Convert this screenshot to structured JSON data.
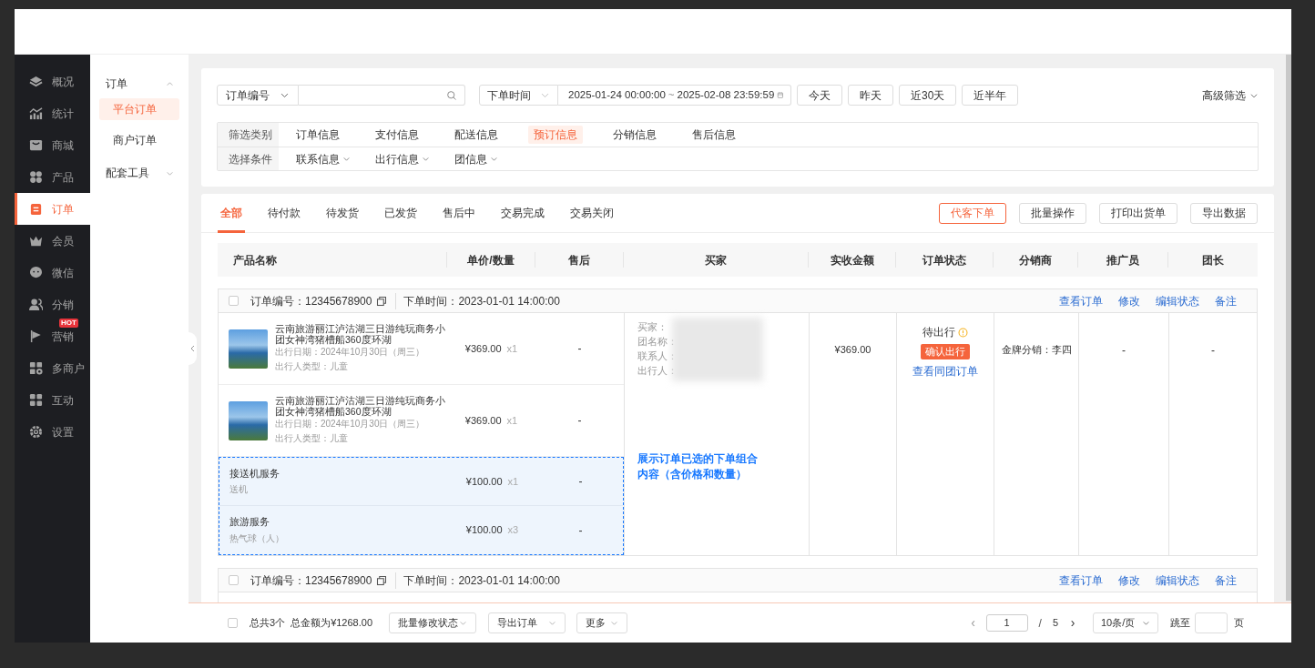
{
  "sidebar": {
    "items": [
      {
        "label": "概况",
        "selected": false
      },
      {
        "label": "统计",
        "selected": false
      },
      {
        "label": "商城",
        "selected": false
      },
      {
        "label": "产品",
        "selected": false
      },
      {
        "label": "订单",
        "selected": true
      },
      {
        "label": "会员",
        "selected": false
      },
      {
        "label": "微信",
        "selected": false
      },
      {
        "label": "分销",
        "selected": false
      },
      {
        "label": "营销",
        "selected": false,
        "badge": "HOT"
      },
      {
        "label": "多商户",
        "selected": false
      },
      {
        "label": "互动",
        "selected": false
      },
      {
        "label": "设置",
        "selected": false
      }
    ]
  },
  "submenu": {
    "groups": [
      {
        "label": "订单",
        "expanded": true,
        "children": [
          {
            "label": "平台订单",
            "selected": true
          },
          {
            "label": "商户订单",
            "selected": false
          }
        ]
      },
      {
        "label": "配套工具",
        "expanded": false
      }
    ]
  },
  "filters": {
    "search": {
      "type_select": "订单编号"
    },
    "date": {
      "type_select": "下单时间",
      "start": "2025-01-24 00:00:00",
      "separator": "~",
      "end": "2025-02-08 23:59:59"
    },
    "quick_buttons": [
      "今天",
      "昨天",
      "近30天",
      "近半年"
    ],
    "advanced": "高级筛选",
    "rows": [
      {
        "label": "筛选类别",
        "options": [
          {
            "label": "订单信息",
            "selected": false
          },
          {
            "label": "支付信息",
            "selected": false
          },
          {
            "label": "配送信息",
            "selected": false
          },
          {
            "label": "预订信息",
            "selected": true
          },
          {
            "label": "分销信息",
            "selected": false
          },
          {
            "label": "售后信息",
            "selected": false
          }
        ]
      },
      {
        "label": "选择条件",
        "dropdowns": [
          "联系信息",
          "出行信息",
          "团信息"
        ]
      }
    ]
  },
  "orders_panel": {
    "tabs": [
      {
        "label": "全部",
        "selected": true
      },
      {
        "label": "待付款",
        "selected": false
      },
      {
        "label": "待发货",
        "selected": false
      },
      {
        "label": "已发货",
        "selected": false
      },
      {
        "label": "售后中",
        "selected": false
      },
      {
        "label": "交易完成",
        "selected": false
      },
      {
        "label": "交易关闭",
        "selected": false
      }
    ],
    "actions": [
      {
        "label": "代客下单",
        "kind": "primary"
      },
      {
        "label": "批量操作",
        "kind": "default"
      },
      {
        "label": "打印出货单",
        "kind": "default"
      },
      {
        "label": "导出数据",
        "kind": "default"
      }
    ],
    "columns": [
      "产品名称",
      "单价/数量",
      "售后",
      "买家",
      "实收金额",
      "订单状态",
      "分销商",
      "推广员",
      "团长"
    ],
    "orders": [
      {
        "checked": false,
        "number_label": "订单编号：",
        "number": "12345678900",
        "time_label": "下单时间：",
        "time": "2023-01-01 14:00:00",
        "links": [
          "查看订单",
          "修改",
          "编辑状态",
          "备注"
        ],
        "items": [
          {
            "kind": "product",
            "highlighted": false,
            "title": "云南旅游丽江泸沽湖三日游纯玩商务小团女神湾猪槽船360度环湖",
            "lines": [
              "出行日期：2024年10月30日（周三）",
              "出行人类型：儿童"
            ],
            "price": "¥369.00",
            "qty": "x1",
            "after_sale": "-"
          },
          {
            "kind": "product",
            "highlighted": false,
            "title": "云南旅游丽江泸沽湖三日游纯玩商务小团女神湾猪槽船360度环湖",
            "lines": [
              "出行日期：2024年10月30日（周三）",
              "出行人类型：儿童"
            ],
            "price": "¥369.00",
            "qty": "x1",
            "after_sale": "-"
          },
          {
            "kind": "service",
            "highlighted": true,
            "title": "接送机服务",
            "lines": [
              "送机"
            ],
            "price": "¥100.00",
            "qty": "x1",
            "after_sale": "-"
          },
          {
            "kind": "service",
            "highlighted": true,
            "title": "旅游服务",
            "lines": [
              "热气球（人）"
            ],
            "price": "¥100.00",
            "qty": "x3",
            "after_sale": "-"
          }
        ],
        "buyer": {
          "fields": [
            "买家：",
            "团名称：",
            "联系人：",
            "出行人："
          ],
          "note": "展示订单已选的下单组合内容（含价格和数量）"
        },
        "amount": "¥369.00",
        "status": {
          "label": "待出行",
          "button": "确认出行",
          "link": "查看同团订单"
        },
        "distributor": "金牌分销：李四",
        "promoter": "-",
        "leader": "-"
      },
      {
        "checked": false,
        "number_label": "订单编号：",
        "number": "12345678900",
        "time_label": "下单时间：",
        "time": "2023-01-01 14:00:00",
        "links": [
          "查看订单",
          "修改",
          "编辑状态",
          "备注"
        ]
      }
    ]
  },
  "footer": {
    "checked": false,
    "count": "总共3个",
    "total": "总金额为¥1268.00",
    "selects": [
      "批量修改状态",
      "导出订单",
      "更多"
    ],
    "pagination": {
      "prev": "‹",
      "page": "1",
      "separator": "/",
      "pages": "5",
      "next": "›",
      "page_size": "10条/页",
      "jump_label": "跳至",
      "jump_suffix": "页"
    }
  }
}
